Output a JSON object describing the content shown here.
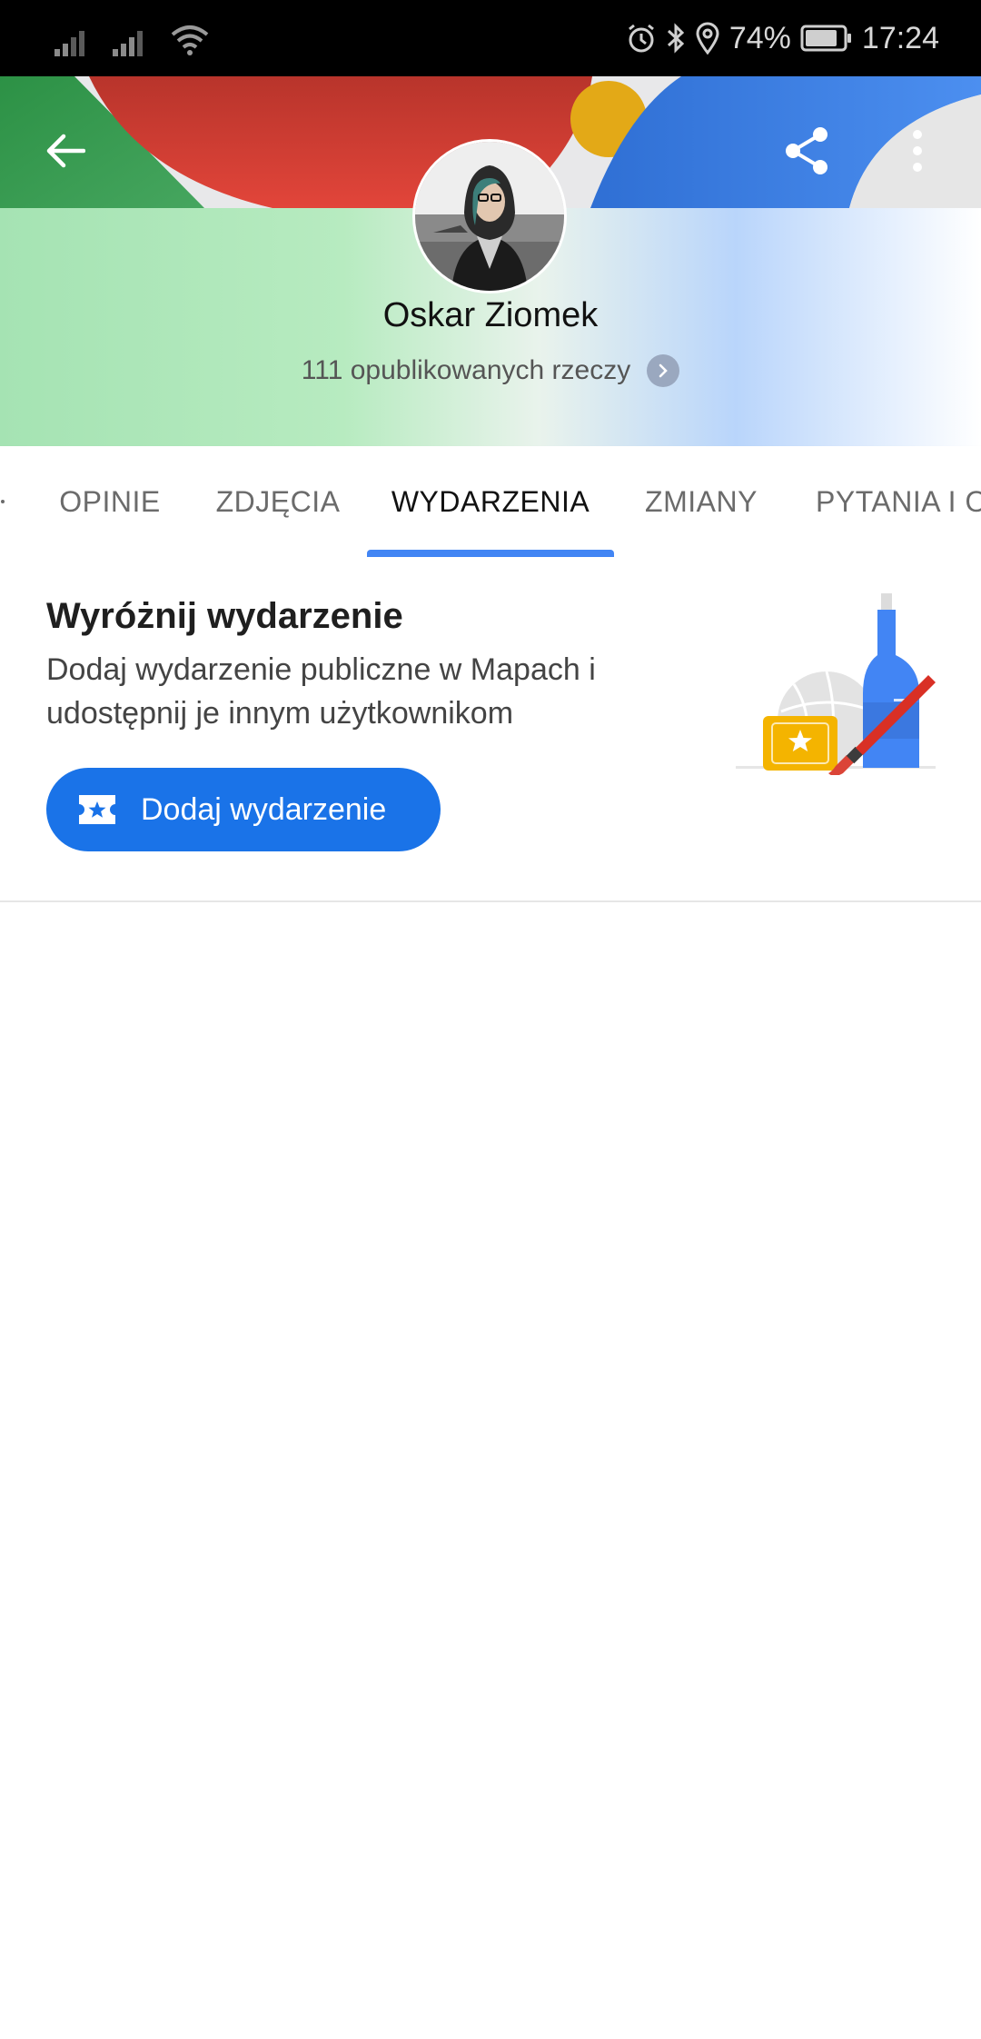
{
  "status_bar": {
    "battery": "74%",
    "time": "17:24"
  },
  "profile": {
    "name": "Oskar Ziomek",
    "published": "111 opublikowanych rzeczy"
  },
  "tabs": [
    {
      "label": "OPINIE"
    },
    {
      "label": "ZDJĘCIA"
    },
    {
      "label": "WYDARZENIA"
    },
    {
      "label": "ZMIANY"
    },
    {
      "label": "PYTANIA I ODPOWIEDZI"
    }
  ],
  "active_tab": "WYDARZENIA",
  "promo": {
    "title": "Wyróżnij wydarzenie",
    "description": "Dodaj wydarzenie publiczne w Mapach i udostępnij je innym użytkownikom",
    "button_label": "Dodaj wydarzenie"
  },
  "colors": {
    "accent_blue": "#1a73e8",
    "tab_indicator": "#4285f4",
    "google_red": "#db3a2c",
    "google_green": "#34a853",
    "google_yellow": "#f2b705"
  }
}
